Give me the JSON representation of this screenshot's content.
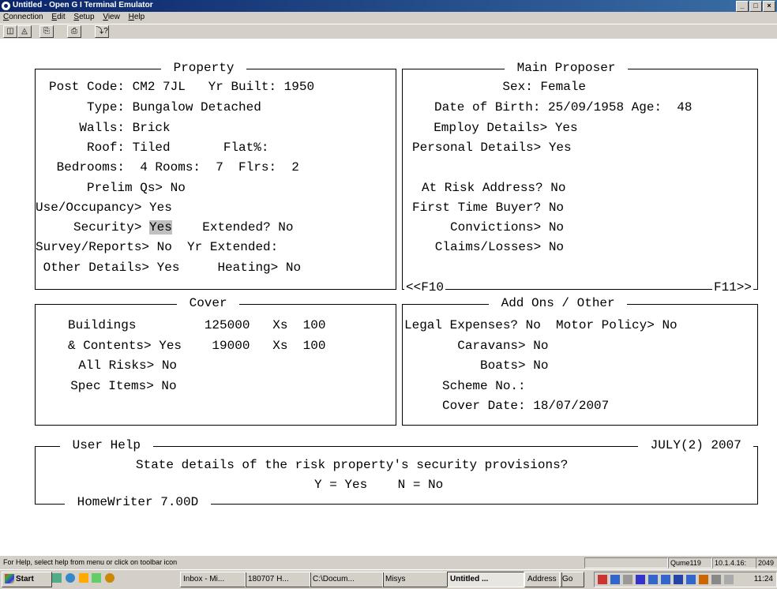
{
  "window": {
    "title": "Untitled - Open G I Terminal Emulator",
    "controls": [
      "_",
      "□",
      "×"
    ]
  },
  "menu": [
    "Connection",
    "Edit",
    "Setup",
    "View",
    "Help"
  ],
  "toolbar": [
    "connect-icon",
    "disconnect-icon",
    "copy-icon",
    "print-icon",
    "help-icon"
  ],
  "property": {
    "legend": " Property ",
    "lines": [
      "Post Code: CM2 7JL   Yr Built: 1950",
      "     Type: Bungalow Detached",
      "    Walls: Brick",
      "     Roof: Tiled       Flat%:",
      " Bedrooms:  4 Rooms:  7  Flrs:  2",
      "     Prelim Qs> No",
      "Use/Occupancy> Yes",
      "     Security> ",
      "Survey/Reports> No  Yr Extended:",
      " Other Details> Yes     Heating> No"
    ],
    "security_value": "Yes",
    "security_rest": "    Extended? No"
  },
  "proposer": {
    "legend": " Main Proposer ",
    "lines": [
      "         Sex: Female",
      "Date of Birth: 25/09/1958 Age:  48",
      "  Employ Details> Yes",
      "Personal Details> Yes",
      "",
      "At Risk Address? No",
      "First Time Buyer? No",
      "     Convictions> No",
      "   Claims/Losses> No"
    ],
    "f10": "<<F10",
    "f11": "F11>>"
  },
  "cover": {
    "legend": " Cover ",
    "lines": [
      "Buildings         125000   Xs  100",
      "& Contents> Yes    19000   Xs  100",
      "  All Risks> No",
      "  Spec Items> No"
    ]
  },
  "addons": {
    "legend": " Add Ons / Other ",
    "lines": [
      "Legal Expenses? No  Motor Policy> No",
      "       Caravans> No",
      "          Boats> No",
      "     Scheme No.:",
      "     Cover Date: 18/07/2007"
    ]
  },
  "help": {
    "legend_left": " User Help ",
    "legend_right": " JULY(2) 2007 ",
    "question": "State details of the risk property's security provisions?",
    "options": "Y = Yes    N = No",
    "footer": " HomeWriter 7.00D "
  },
  "status": {
    "text": "For Help, select help from menu or click on toolbar icon",
    "machine": "Qume119",
    "ip": "10.1.4.16:",
    "port": "2049"
  },
  "taskbar": {
    "start": "Start",
    "tasks": [
      "Inbox - Mi...",
      "180707 H...",
      "C:\\Docum...",
      "Misys",
      "Untitled ...",
      "Address",
      "Go"
    ],
    "clock": "11:24"
  }
}
